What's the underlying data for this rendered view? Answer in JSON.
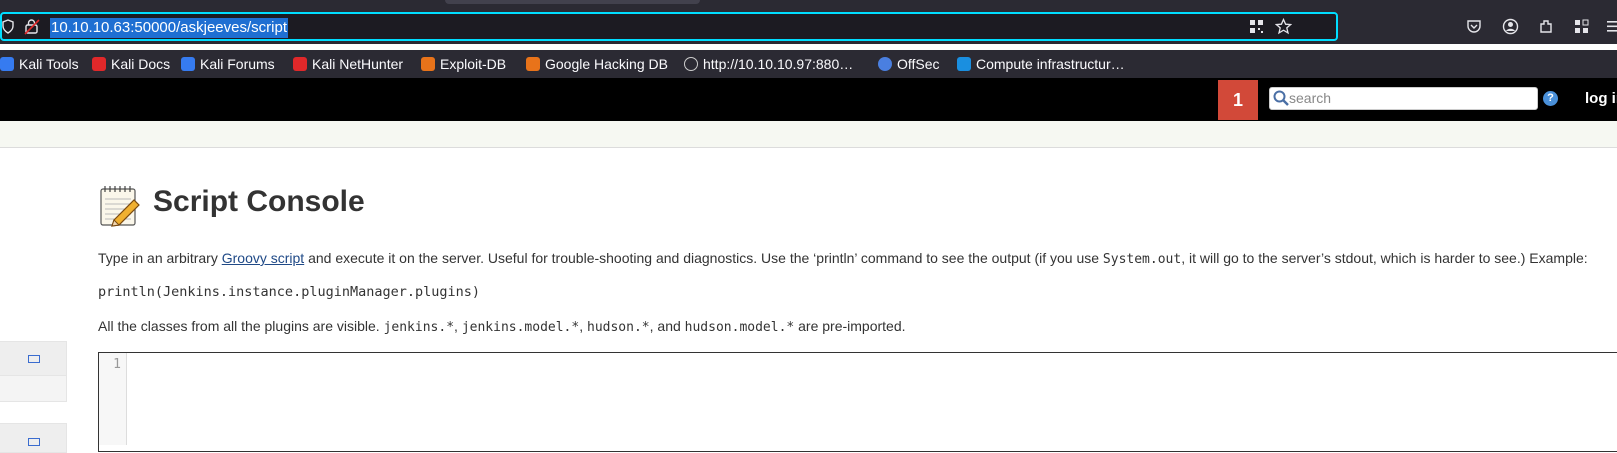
{
  "browser": {
    "url": "10.10.10.63:50000/askjeeves/script",
    "bookmarks": [
      {
        "label": "Kali Tools",
        "icon": "kali-dragon-icon",
        "color": "#367bf0"
      },
      {
        "label": "Kali Docs",
        "icon": "kali-docs-icon",
        "color": "#e0282a"
      },
      {
        "label": "Kali Forums",
        "icon": "kali-forums-icon",
        "color": "#367bf0"
      },
      {
        "label": "Kali NetHunter",
        "icon": "nethunter-icon",
        "color": "#e0282a"
      },
      {
        "label": "Exploit-DB",
        "icon": "exploit-db-icon",
        "color": "#e8731a"
      },
      {
        "label": "Google Hacking DB",
        "icon": "ghdb-icon",
        "color": "#e8731a"
      },
      {
        "label": "http://10.10.10.97:880…",
        "icon": "globe-icon",
        "color": "#cccccc"
      },
      {
        "label": "OffSec",
        "icon": "offsec-icon",
        "color": "#4a7fe0"
      },
      {
        "label": "Compute infrastructur…",
        "icon": "azure-icon",
        "color": "#1a8fe0"
      }
    ]
  },
  "header": {
    "notification_count": "1",
    "search_placeholder": "search",
    "help": "?",
    "login": "log in"
  },
  "page": {
    "title": "Script Console",
    "intro_before_link": "Type in an arbitrary ",
    "intro_link": "Groovy script",
    "intro_middle": " and execute it on the server. Useful for trouble-shooting and diagnostics. Use the ‘println’ command to see the output (if you use ",
    "intro_code": "System.out",
    "intro_after": ", it will go to the server’s stdout, which is harder to see.) Example:",
    "example_code": "println(Jenkins.instance.pluginManager.plugins)",
    "classes_before": "All the classes from all the plugins are visible. ",
    "classes_code_1": "jenkins.*",
    "classes_sep_1": ", ",
    "classes_code_2": "jenkins.model.*",
    "classes_sep_2": ", ",
    "classes_code_3": "hudson.*",
    "classes_sep_3": ", and ",
    "classes_code_4": "hudson.model.*",
    "classes_after": " are pre-imported.",
    "editor_line_number": "1"
  },
  "colors": {
    "jenkins_red": "#d24939",
    "url_highlight": "#1f6fd2",
    "focus_ring": "#00ddff"
  }
}
